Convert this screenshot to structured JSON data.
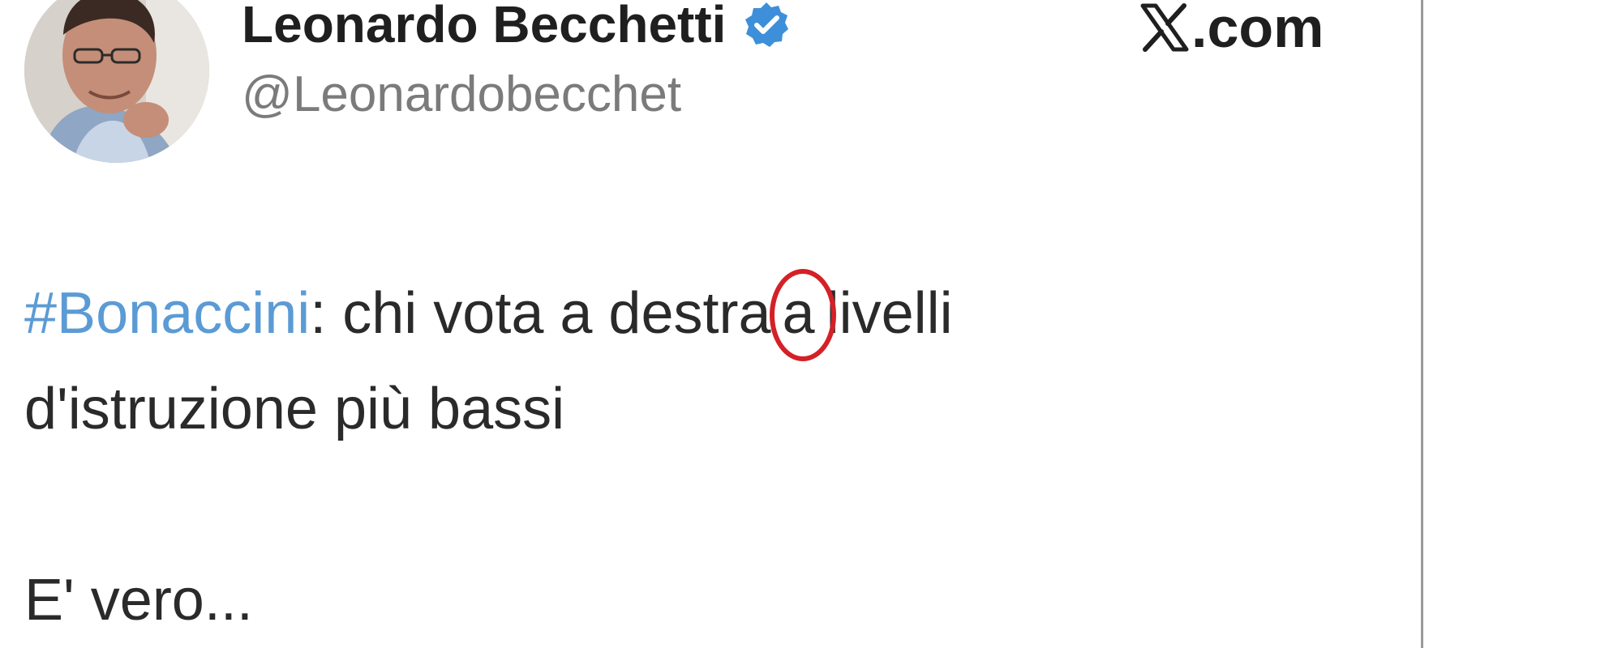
{
  "profile": {
    "display_name": "Leonardo Becchetti",
    "handle": "@Leonardobecchet",
    "verified_icon": "verified-badge-icon",
    "avatar_icon": "avatar"
  },
  "brand": {
    "icon": "x-logo-icon",
    "text": ".com"
  },
  "tweet": {
    "hashtag": "#Bonaccini",
    "line1_rest_before": ": chi vota a destra",
    "highlighted_word": "a",
    "line1_rest_after": "livelli",
    "line2": "d'istruzione più bassi",
    "line3": "E' vero..."
  },
  "colors": {
    "hashtag": "#5b9bd5",
    "verified_badge": "#3d8fd9",
    "highlight_circle": "#d32127",
    "text": "#2a2a2a",
    "handle": "#7b7b7b"
  }
}
